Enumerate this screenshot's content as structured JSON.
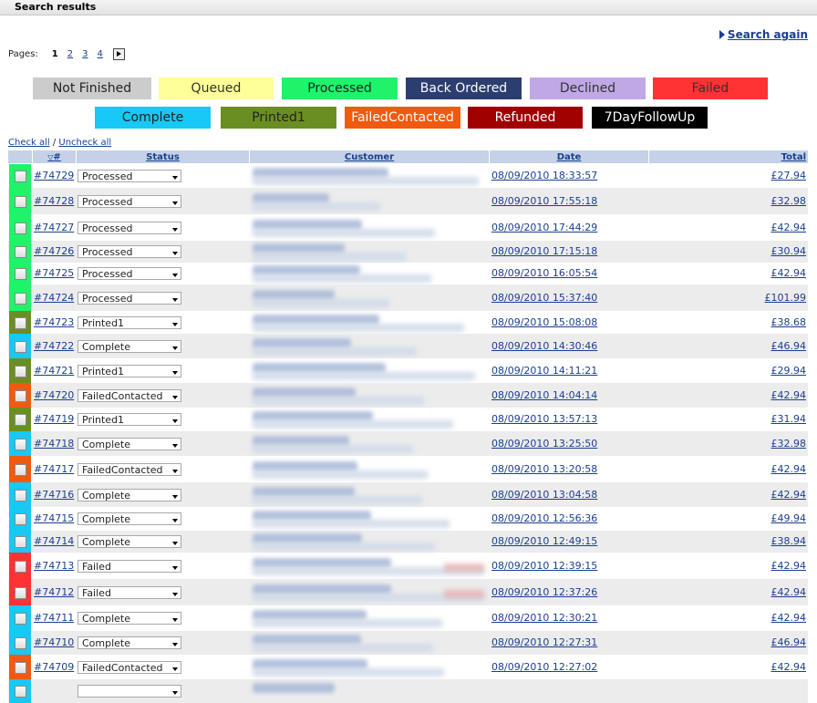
{
  "header": {
    "title": "Search results"
  },
  "search_again": "Search again",
  "pager": {
    "label": "Pages:",
    "current": "1",
    "pages": [
      "2",
      "3",
      "4"
    ]
  },
  "legend": [
    {
      "label": "Not Finished",
      "color": "#cccccc",
      "text": "#222222"
    },
    {
      "label": "Queued",
      "color": "#ffff99",
      "text": "#333333"
    },
    {
      "label": "Processed",
      "color": "#1ef36a",
      "text": "#222222"
    },
    {
      "label": "Back Ordered",
      "color": "#2b3e6f",
      "text": "#ffffff"
    },
    {
      "label": "Declined",
      "color": "#c0a8e6",
      "text": "#333333"
    },
    {
      "label": "Failed",
      "color": "#ff3333",
      "text": "#333333"
    },
    {
      "label": "Complete",
      "color": "#18c8f5",
      "text": "#222222"
    },
    {
      "label": "Printed1",
      "color": "#6b8e23",
      "text": "#222222"
    },
    {
      "label": "FailedContacted",
      "color": "#f05a10",
      "text": "#ffffff"
    },
    {
      "label": "Refunded",
      "color": "#a00000",
      "text": "#ffffff"
    },
    {
      "label": "7DayFollowUp",
      "color": "#000000",
      "text": "#ffffff"
    }
  ],
  "check_all": "Check all",
  "separator": "/",
  "uncheck_all": "Uncheck all",
  "columns": {
    "id": "#",
    "status": "Status",
    "customer": "Customer",
    "date": "Date",
    "total": "Total"
  },
  "status_colors": {
    "Processed": "#1ef36a",
    "Printed1": "#6b8e23",
    "Complete": "#18c8f5",
    "FailedContacted": "#f05a10",
    "Failed": "#ff3333"
  },
  "orders": [
    {
      "id": "#74729",
      "status": "Processed",
      "date": "08/09/2010 18:33:57",
      "total": "£27.94"
    },
    {
      "id": "#74728",
      "status": "Processed",
      "date": "08/09/2010 17:55:18",
      "total": "£32.98"
    },
    {
      "id": "#74727",
      "status": "Processed",
      "date": "08/09/2010 17:44:29",
      "total": "£42.94"
    },
    {
      "id": "#74726",
      "status": "Processed",
      "date": "08/09/2010 17:15:18",
      "total": "£30.94"
    },
    {
      "id": "#74725",
      "status": "Processed",
      "date": "08/09/2010 16:05:54",
      "total": "£42.94"
    },
    {
      "id": "#74724",
      "status": "Processed",
      "date": "08/09/2010 15:37:40",
      "total": "£101.99"
    },
    {
      "id": "#74723",
      "status": "Printed1",
      "date": "08/09/2010 15:08:08",
      "total": "£38.68"
    },
    {
      "id": "#74722",
      "status": "Complete",
      "date": "08/09/2010 14:30:46",
      "total": "£46.94"
    },
    {
      "id": "#74721",
      "status": "Printed1",
      "date": "08/09/2010 14:11:21",
      "total": "£29.94"
    },
    {
      "id": "#74720",
      "status": "FailedContacted",
      "date": "08/09/2010 14:04:14",
      "total": "£42.94"
    },
    {
      "id": "#74719",
      "status": "Printed1",
      "date": "08/09/2010 13:57:13",
      "total": "£31.94"
    },
    {
      "id": "#74718",
      "status": "Complete",
      "date": "08/09/2010 13:25:50",
      "total": "£32.98"
    },
    {
      "id": "#74717",
      "status": "FailedContacted",
      "date": "08/09/2010 13:20:58",
      "total": "£42.94"
    },
    {
      "id": "#74716",
      "status": "Complete",
      "date": "08/09/2010 13:04:58",
      "total": "£42.94"
    },
    {
      "id": "#74715",
      "status": "Complete",
      "date": "08/09/2010 12:56:36",
      "total": "£49.94"
    },
    {
      "id": "#74714",
      "status": "Complete",
      "date": "08/09/2010 12:49:15",
      "total": "£38.94"
    },
    {
      "id": "#74713",
      "status": "Failed",
      "date": "08/09/2010 12:39:15",
      "total": "£42.94"
    },
    {
      "id": "#74712",
      "status": "Failed",
      "date": "08/09/2010 12:37:26",
      "total": "£42.94"
    },
    {
      "id": "#74711",
      "status": "Complete",
      "date": "08/09/2010 12:30:21",
      "total": "£42.94"
    },
    {
      "id": "#74710",
      "status": "Complete",
      "date": "08/09/2010 12:27:31",
      "total": "£46.94"
    },
    {
      "id": "#74709",
      "status": "FailedContacted",
      "date": "08/09/2010 12:27:02",
      "total": "£42.94"
    }
  ]
}
